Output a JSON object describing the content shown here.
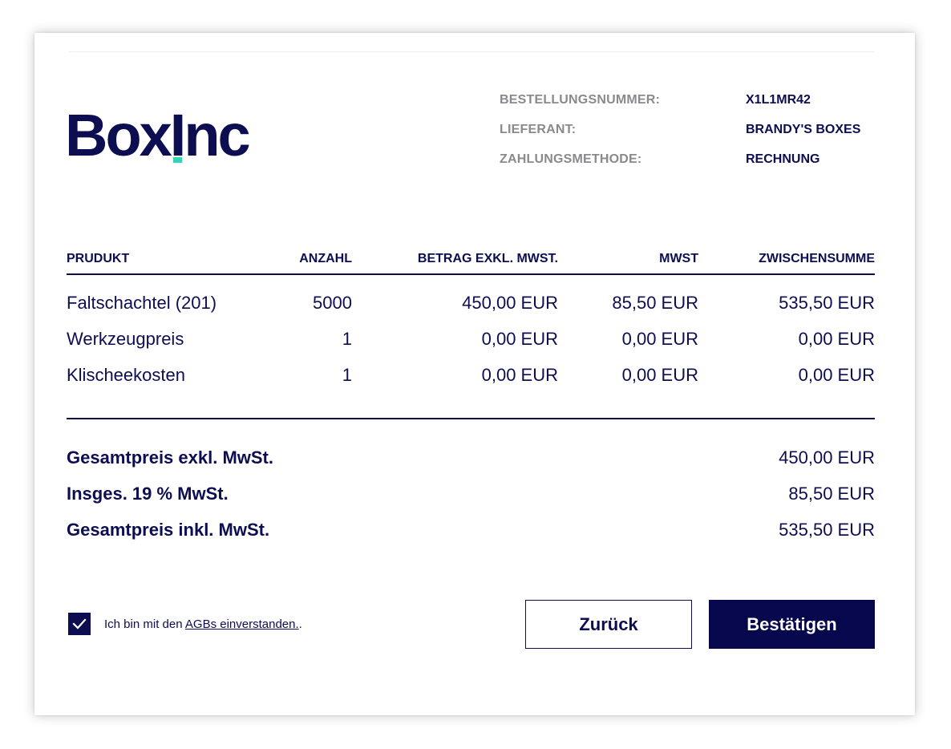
{
  "brand": {
    "name": "BoxInc",
    "accent_color": "#2fd8b3",
    "primary_color": "#0d0d52"
  },
  "order": {
    "fields": [
      {
        "label": "BESTELLUNGSNUMMER:",
        "value": "X1L1MR42"
      },
      {
        "label": "LIEFERANT:",
        "value": "BRANDY'S BOXES"
      },
      {
        "label": "ZAHLUNGSMETHODE:",
        "value": "RECHNUNG"
      }
    ]
  },
  "table": {
    "headers": [
      "PRUDUKT",
      "ANZAHL",
      "BETRAG EXKL. MWST.",
      "MWST",
      "ZWISCHENSUMME"
    ],
    "rows": [
      [
        "Faltschachtel (201)",
        "5000",
        "450,00 EUR",
        "85,50 EUR",
        "535,50 EUR"
      ],
      [
        "Werkzeugpreis",
        "1",
        "0,00 EUR",
        "0,00 EUR",
        "0,00 EUR"
      ],
      [
        "Klischeekosten",
        "1",
        "0,00 EUR",
        "0,00 EUR",
        "0,00 EUR"
      ]
    ]
  },
  "totals": [
    {
      "label": "Gesamtpreis exkl. MwSt.",
      "value": "450,00 EUR"
    },
    {
      "label": "Insges. 19 % MwSt.",
      "value": "85,50 EUR"
    },
    {
      "label": "Gesamtpreis inkl. MwSt.",
      "value": "535,50 EUR"
    }
  ],
  "terms": {
    "checked": true,
    "prefix": "Ich bin mit den ",
    "link": "AGBs einverstanden.",
    "suffix": "."
  },
  "actions": {
    "back_label": "Zurück",
    "confirm_label": "Bestätigen"
  }
}
